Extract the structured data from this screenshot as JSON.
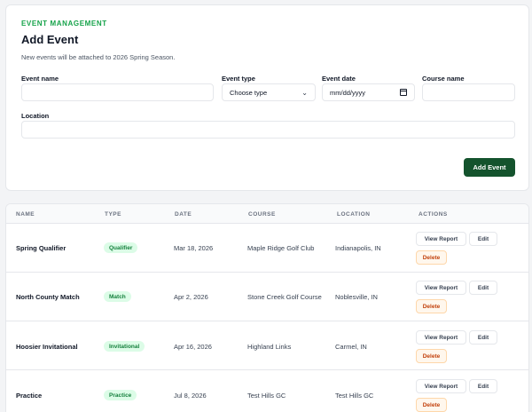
{
  "header": {
    "eyebrow": "EVENT MANAGEMENT",
    "title": "Add Event",
    "subtitle": "New events will be attached to 2026 Spring Season."
  },
  "form": {
    "event_name_label": "Event name",
    "event_name_value": "",
    "event_type_label": "Event type",
    "event_type_value": "Choose type",
    "event_date_label": "Event date",
    "event_date_value": "mm/dd/yyyy",
    "course_name_label": "Course name",
    "course_name_value": "",
    "location_label": "Location",
    "location_value": "",
    "submit_label": "Add Event"
  },
  "table": {
    "columns": [
      "NAME",
      "TYPE",
      "DATE",
      "COURSE",
      "LOCATION",
      "ACTIONS"
    ],
    "rows": [
      {
        "name": "Spring Qualifier",
        "type": "Qualifier",
        "date": "Mar 18, 2026",
        "course": "Maple Ridge Golf Club",
        "location": "Indianapolis, IN"
      },
      {
        "name": "North County Match",
        "type": "Match",
        "date": "Apr 2, 2026",
        "course": "Stone Creek Golf Course",
        "location": "Noblesville, IN"
      },
      {
        "name": "Hoosier Invitational",
        "type": "Invitational",
        "date": "Apr 16, 2026",
        "course": "Highland Links",
        "location": "Carmel, IN"
      },
      {
        "name": "Practice",
        "type": "Practice",
        "date": "Jul 8, 2026",
        "course": "Test Hills GC",
        "location": "Test Hills GC"
      }
    ],
    "actions": {
      "view": "View Report",
      "edit": "Edit",
      "delete": "Delete"
    }
  },
  "colors": {
    "accent": "#14532d",
    "eyebrow": "#16a34a",
    "badge_bg": "#dcfce7",
    "delete_text": "#c2410c"
  },
  "icons": {
    "select": "chevron-down-icon",
    "date": "calendar-icon"
  }
}
